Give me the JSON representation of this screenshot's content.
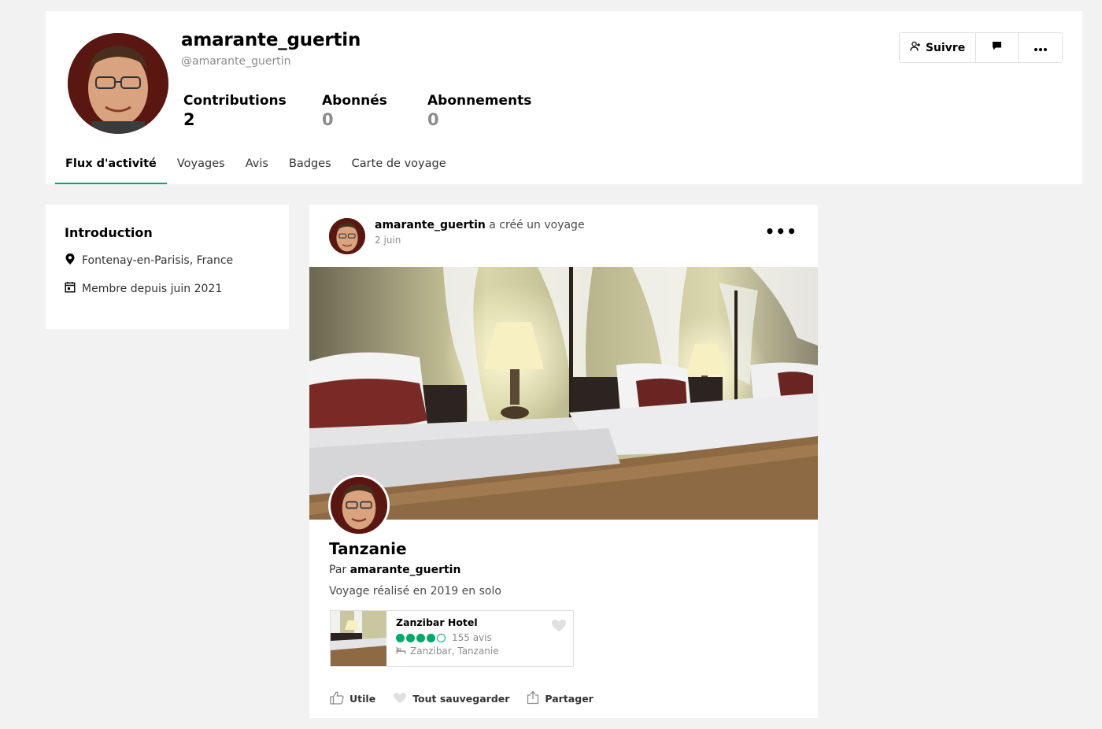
{
  "profile": {
    "display_name": "amarante_guertin",
    "handle": "@amarante_guertin",
    "stats": [
      {
        "label": "Contributions",
        "value": "2"
      },
      {
        "label": "Abonnés",
        "value": "0"
      },
      {
        "label": "Abonnements",
        "value": "0"
      }
    ],
    "actions": {
      "follow_label": "Suivre",
      "message_icon": "chat-icon",
      "more_icon": "more-dots-icon"
    }
  },
  "tabs": [
    {
      "label": "Flux d'activité",
      "active": true
    },
    {
      "label": "Voyages",
      "active": false
    },
    {
      "label": "Avis",
      "active": false
    },
    {
      "label": "Badges",
      "active": false
    },
    {
      "label": "Carte de voyage",
      "active": false
    }
  ],
  "intro": {
    "title": "Introduction",
    "location": "Fontenay-en-Parisis, France",
    "member_since": "Membre depuis juin 2021"
  },
  "post": {
    "user": "amarante_guertin",
    "action": "a créé un voyage",
    "date": "2 juin",
    "more_label": "•••",
    "trip": {
      "title": "Tanzanie",
      "by_prefix": "Par",
      "by_user": "amarante_guertin",
      "description": "Voyage réalisé en 2019 en solo"
    },
    "hotel": {
      "name": "Zanzibar Hotel",
      "rating": 4,
      "rating_max": 5,
      "reviews": "155 avis",
      "location": "Zanzibar, Tanzanie"
    },
    "actions": {
      "useful": "Utile",
      "save": "Tout sauvegarder",
      "share": "Partager"
    }
  },
  "colors": {
    "accent": "#00aa6c",
    "background": "#f2f2f2",
    "muted_text": "#8c8c8c"
  }
}
